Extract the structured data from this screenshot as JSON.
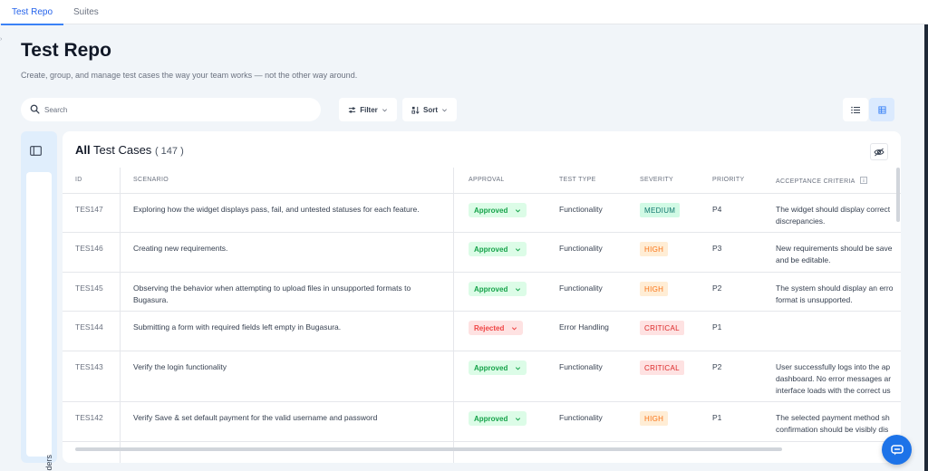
{
  "tabs": [
    {
      "label": "Test Repo",
      "active": true
    },
    {
      "label": "Suites",
      "active": false
    }
  ],
  "header": {
    "title": "Test Repo",
    "subtitle": "Create, group, and manage test cases the way your team works — not the other way around."
  },
  "search": {
    "placeholder": "Search",
    "value": ""
  },
  "toolbar": {
    "filter_label": "Filter",
    "sort_label": "Sort"
  },
  "folders": {
    "label": "Folders"
  },
  "table": {
    "title_bold": "All",
    "title_rest": " Test Cases",
    "count": "( 147 )",
    "columns": [
      "ID",
      "SCENARIO",
      "APPROVAL",
      "TEST TYPE",
      "SEVERITY",
      "PRIORITY",
      "ACCEPTANCE CRITERIA"
    ],
    "rows": [
      {
        "id": "TES147",
        "scenario": "Exploring how the widget displays pass, fail, and untested statuses for each feature.",
        "approval": "Approved",
        "type": "Functionality",
        "severity": "MEDIUM",
        "priority": "P4",
        "acceptance": "The widget should display correct\ndiscrepancies."
      },
      {
        "id": "TES146",
        "scenario": "Creating new requirements.",
        "approval": "Approved",
        "type": "Functionality",
        "severity": "HIGH",
        "priority": "P3",
        "acceptance": "New requirements should be save\nand be editable."
      },
      {
        "id": "TES145",
        "scenario": "Observing the behavior when attempting to upload files in unsupported formats to Bugasura.",
        "approval": "Approved",
        "type": "Functionality",
        "severity": "HIGH",
        "priority": "P2",
        "acceptance": "The system should display an erro\nformat is unsupported."
      },
      {
        "id": "TES144",
        "scenario": "Submitting a form with required fields left empty in Bugasura.",
        "approval": "Rejected",
        "type": "Error Handling",
        "severity": "CRITICAL",
        "priority": "P1",
        "acceptance": ""
      },
      {
        "id": "TES143",
        "scenario": "Verify the login functionality",
        "approval": "Approved",
        "type": "Functionality",
        "severity": "CRITICAL",
        "priority": "P2",
        "acceptance": "User successfully logs into the ap\ndashboard. No error messages ar\ninterface loads with the correct us"
      },
      {
        "id": "TES142",
        "scenario": "Verify Save & set default payment for the valid username and password",
        "approval": "Approved",
        "type": "Functionality",
        "severity": "HIGH",
        "priority": "P1",
        "acceptance": "The selected payment method sh\nconfirmation should be visibly dis"
      }
    ]
  },
  "colors": {
    "accent": "#3b82f6",
    "approved_bg": "#dcfce7",
    "rejected_bg": "#fee2e2",
    "chat": "#1d73e8"
  },
  "icons": [
    "search-icon",
    "filter-icon",
    "sort-icon",
    "chevron-down-icon",
    "list-view-icon",
    "grid-view-icon",
    "sidebar-toggle-icon",
    "folder-icon",
    "eye-off-icon",
    "info-icon",
    "chat-icon"
  ]
}
